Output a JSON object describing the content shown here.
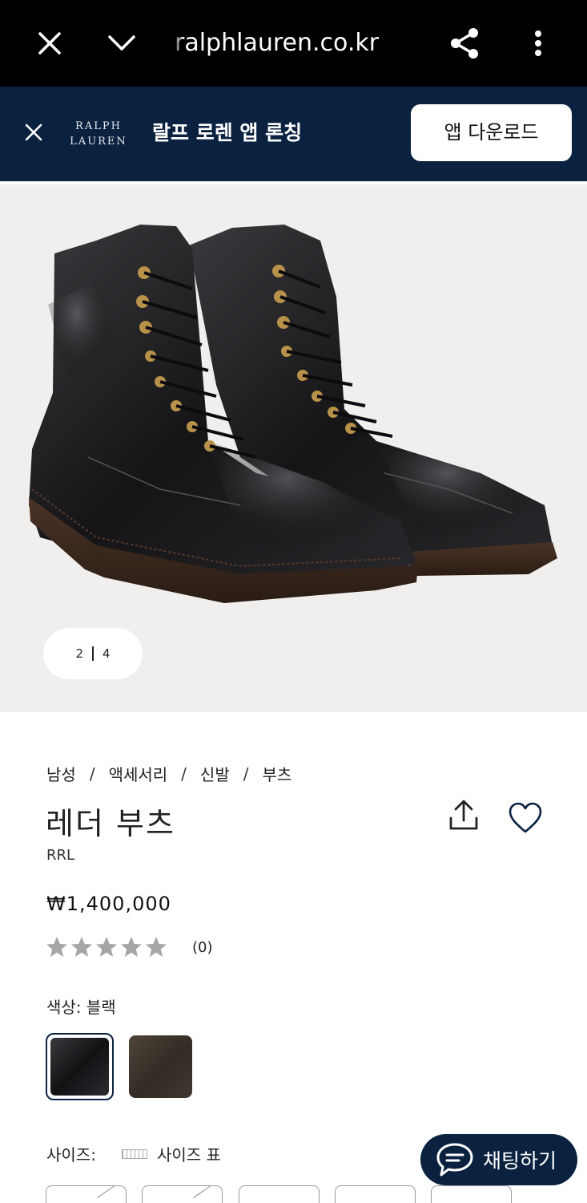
{
  "browser": {
    "url": "ralphlauren.co.kr",
    "close_icon": "close-icon",
    "collapse_icon": "chevron-down-icon",
    "share_icon": "share-icon",
    "menu_icon": "more-vert-icon"
  },
  "app_banner": {
    "logo_line1": "RALPH",
    "logo_line2": "LAUREN",
    "title": "랄프 로렌 앱 론칭",
    "download_label": "앱 다운로드",
    "background": "#0a2240"
  },
  "gallery": {
    "current": "2",
    "total": "4"
  },
  "breadcrumb": [
    "남성",
    "액세서리",
    "신발",
    "부츠"
  ],
  "product": {
    "title": "레더 부츠",
    "brand": "RRL",
    "price": "₩1,400,000",
    "rating": 0,
    "review_count": "(0)"
  },
  "color": {
    "label": "색상: 블랙",
    "options": [
      "블랙",
      "브라운"
    ],
    "selected": "블랙"
  },
  "size": {
    "label": "사이즈:",
    "chart_label": "사이즈 표"
  },
  "chat": {
    "label": "채팅하기"
  }
}
